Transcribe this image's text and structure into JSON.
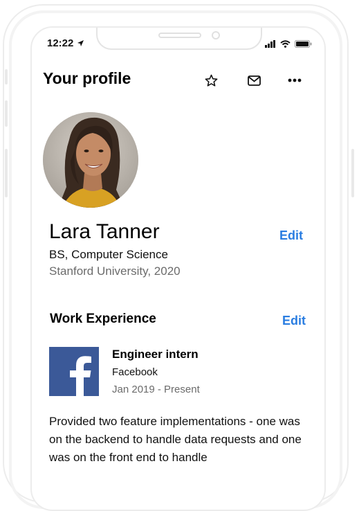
{
  "status_bar": {
    "time": "12:22"
  },
  "header": {
    "title": "Your profile"
  },
  "profile": {
    "name": "Lara Tanner",
    "degree": "BS, Computer Science",
    "school": "Stanford University, 2020",
    "edit_label": "Edit"
  },
  "work_experience": {
    "title": "Work Experience",
    "edit_label": "Edit",
    "items": [
      {
        "role": "Engineer intern",
        "company": "Facebook",
        "dates": "Jan 2019 - Present",
        "description": "Provided two feature implementations - one was on the backend to handle data requests and one was on the front end to handle"
      }
    ]
  },
  "colors": {
    "accent": "#2a7de1",
    "facebook_blue": "#3b5998"
  }
}
